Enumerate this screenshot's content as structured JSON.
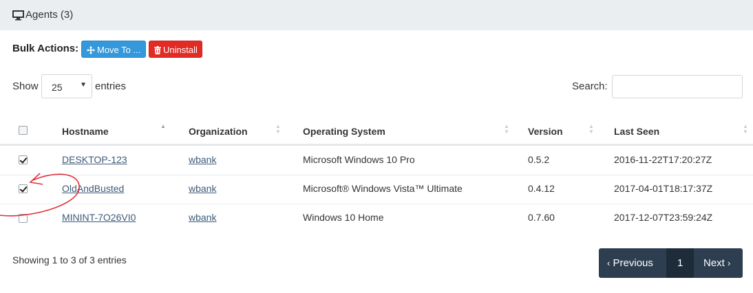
{
  "panel": {
    "title": "Agents (3)"
  },
  "bulk": {
    "label": "Bulk Actions:",
    "move_label": "Move To ...",
    "uninstall_label": "Uninstall"
  },
  "length": {
    "show": "Show",
    "selected": "25",
    "entries": "entries"
  },
  "search": {
    "label": "Search:",
    "value": ""
  },
  "table": {
    "columns": [
      "Hostname",
      "Organization",
      "Operating System",
      "Version",
      "Last Seen"
    ],
    "rows": [
      {
        "checked": true,
        "hostname": "DESKTOP-123",
        "organization": "wbank",
        "os": "Microsoft Windows 10 Pro",
        "version": "0.5.2",
        "last_seen": "2016-11-22T17:20:27Z"
      },
      {
        "checked": true,
        "hostname": "OldAndBusted",
        "organization": "wbank",
        "os": "Microsoft® Windows Vista™ Ultimate",
        "version": "0.4.12",
        "last_seen": "2017-04-01T18:17:37Z"
      },
      {
        "checked": false,
        "hostname": "MININT-7O26VI0",
        "organization": "wbank",
        "os": "Windows 10 Home",
        "version": "0.7.60",
        "last_seen": "2017-12-07T23:59:24Z"
      }
    ]
  },
  "footer": {
    "info": "Showing 1 to 3 of 3 entries",
    "previous": "Previous",
    "page": "1",
    "next": "Next"
  },
  "colors": {
    "primary": "#3498db",
    "danger": "#e22b25",
    "pager": "#2c3e50",
    "annotation": "#e0303a"
  },
  "icons": {
    "title": "desktop-monitor-icon",
    "move": "arrows-move-icon",
    "uninstall": "trash-icon"
  }
}
